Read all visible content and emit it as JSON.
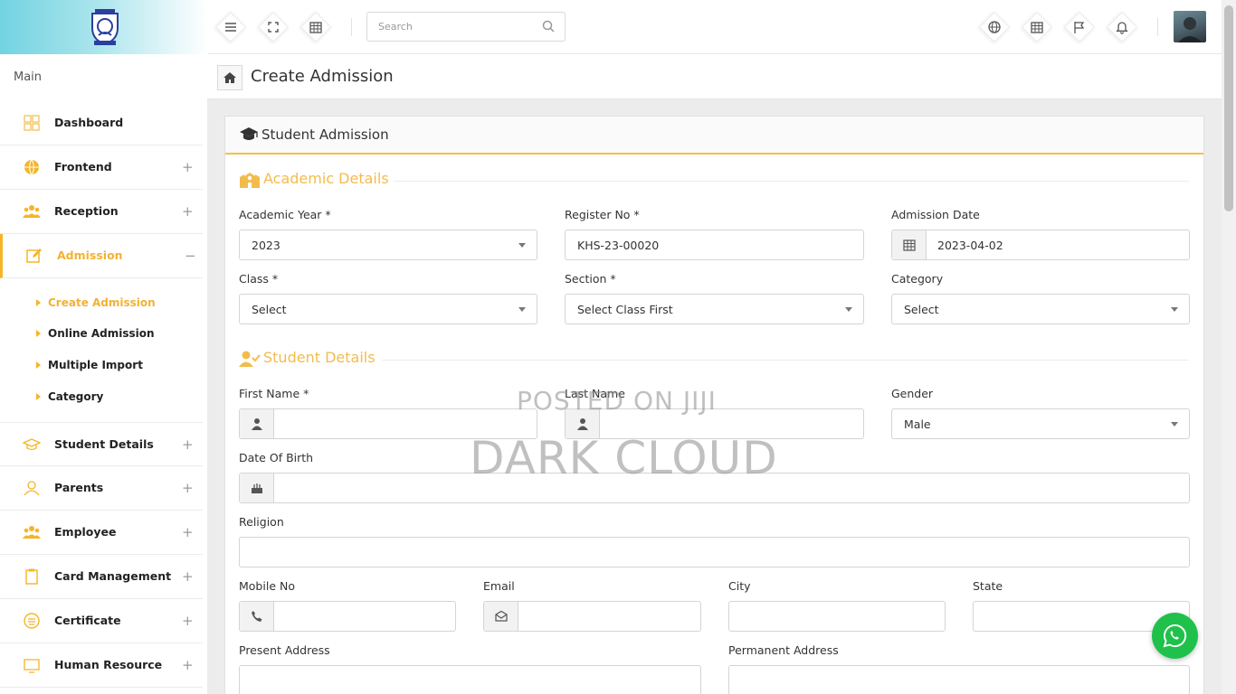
{
  "header": {
    "search_placeholder": "Search",
    "icons": [
      "menu-icon",
      "fullscreen-icon",
      "calendar-icon",
      "globe-icon",
      "calendar-icon",
      "flag-icon",
      "bell-icon"
    ]
  },
  "sidebar": {
    "section_label": "Main",
    "items": [
      {
        "label": "Dashboard",
        "sign": ""
      },
      {
        "label": "Frontend",
        "sign": "+"
      },
      {
        "label": "Reception",
        "sign": "+"
      },
      {
        "label": "Admission",
        "sign": "−"
      },
      {
        "label": "Student Details",
        "sign": "+"
      },
      {
        "label": "Parents",
        "sign": "+"
      },
      {
        "label": "Employee",
        "sign": "+"
      },
      {
        "label": "Card Management",
        "sign": "+"
      },
      {
        "label": "Certificate",
        "sign": "+"
      },
      {
        "label": "Human Resource",
        "sign": "+"
      }
    ],
    "admission_sub": [
      "Create Admission",
      "Online Admission",
      "Multiple Import",
      "Category"
    ]
  },
  "page": {
    "title": "Create Admission"
  },
  "panel": {
    "title": "Student Admission"
  },
  "academic": {
    "section_title": "Academic Details",
    "academic_year_label": "Academic Year *",
    "academic_year_value": "2023",
    "register_no_label": "Register No *",
    "register_no_value": "KHS-23-00020",
    "admission_date_label": "Admission Date",
    "admission_date_value": "2023-04-02",
    "class_label": "Class *",
    "class_value": "Select",
    "section_label": "Section *",
    "section_value": "Select Class First",
    "category_label": "Category",
    "category_value": "Select"
  },
  "student": {
    "section_title": "Student Details",
    "first_name_label": "First Name *",
    "last_name_label": "Last Name",
    "gender_label": "Gender",
    "gender_value": "Male",
    "dob_label": "Date Of Birth",
    "religion_label": "Religion",
    "mobile_label": "Mobile No",
    "email_label": "Email",
    "city_label": "City",
    "state_label": "State",
    "present_address_label": "Present Address",
    "permanent_address_label": "Permanent Address"
  },
  "watermark": {
    "line1": "POSTED ON JIJI",
    "line2": "DARK CLOUD"
  },
  "colors": {
    "accent": "#f5b526",
    "section_title": "#f2bc4d",
    "whatsapp": "#1fc14b"
  }
}
